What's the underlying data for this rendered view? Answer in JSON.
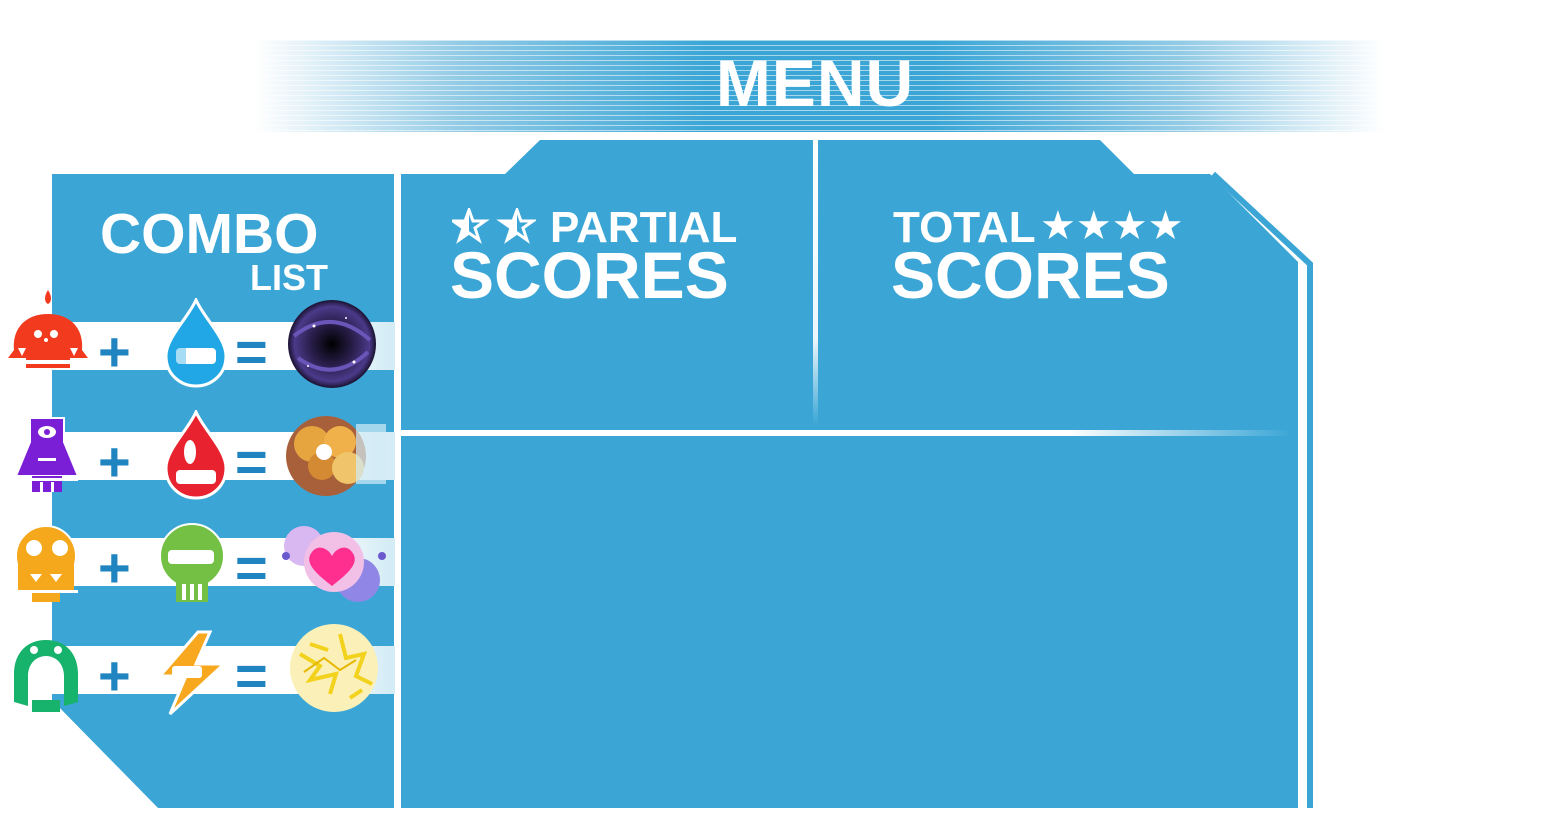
{
  "header": {
    "title": "MENU"
  },
  "combo_list": {
    "title": "COMBO",
    "subtitle": "LIST",
    "rows": [
      {
        "monster": "red-monster-icon",
        "element": "water-drop-icon",
        "result": "black-hole-icon",
        "plus": "+",
        "equals": "="
      },
      {
        "monster": "purple-monster-icon",
        "element": "fire-drop-icon",
        "result": "explosion-icon",
        "plus": "+",
        "equals": "="
      },
      {
        "monster": "yellow-monster-icon",
        "element": "green-skull-icon",
        "result": "heart-burst-icon",
        "plus": "+",
        "equals": "="
      },
      {
        "monster": "green-monster-icon",
        "element": "lightning-icon",
        "result": "electric-ball-icon",
        "plus": "+",
        "equals": "="
      }
    ]
  },
  "partial_scores": {
    "line1": "PARTIAL",
    "line2": "SCORES",
    "stars_icon": "half-star-icon"
  },
  "total_scores": {
    "line1": "TOTAL",
    "line2": "SCORES",
    "stars": "★★★★",
    "stars_icon": "star-icon"
  },
  "colors": {
    "panel": "#3ba6d6",
    "accent": "#1f84bf",
    "white": "#ffffff"
  }
}
